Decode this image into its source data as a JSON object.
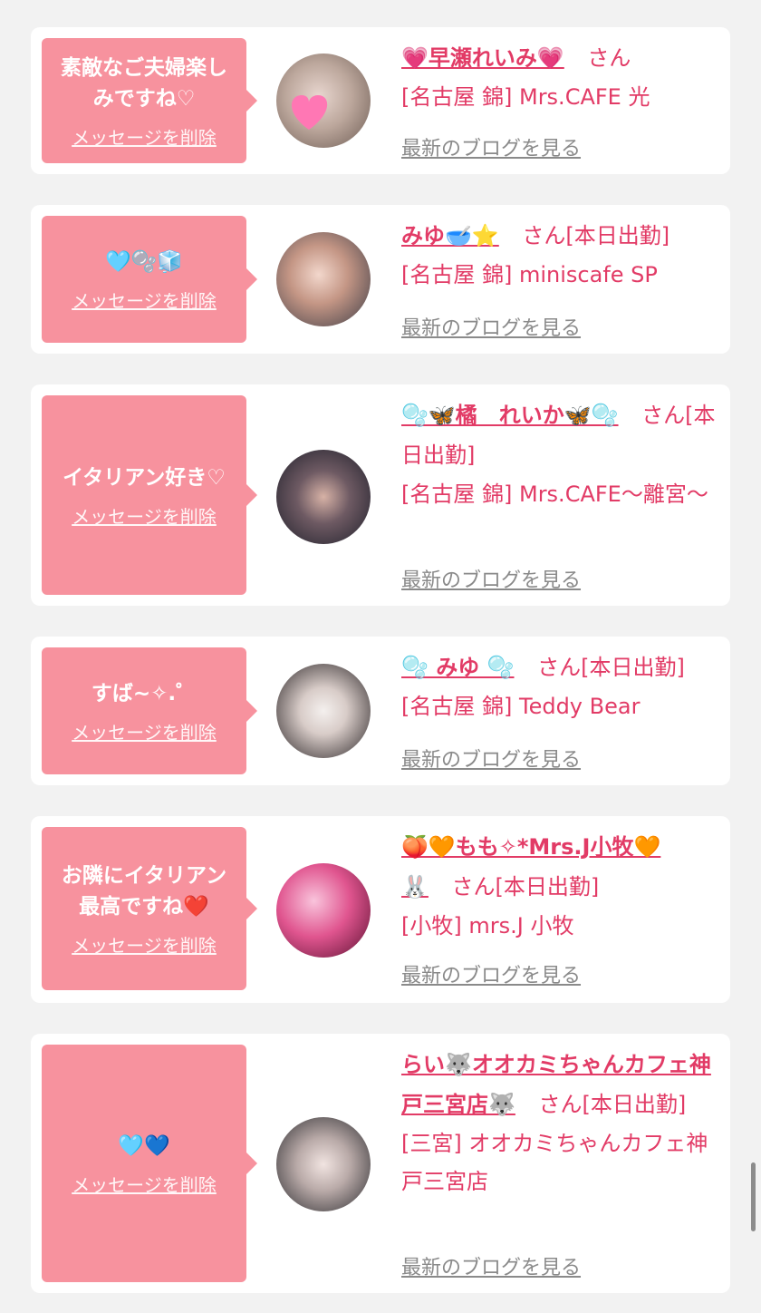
{
  "cards": [
    {
      "message": "素敵なご夫婦楽しみですね♡",
      "delete_label": "メッセージを削除",
      "name": "💗早瀬れいみ💗",
      "san": "さん",
      "status": "",
      "shop": "[名古屋 錦] Mrs.CAFE 光",
      "blog_label": "最新のブログを見る"
    },
    {
      "message": "🩵🫧🧊",
      "delete_label": "メッセージを削除",
      "name": "みゆ🥣⭐️",
      "san": "さん",
      "status": "[本日出勤]",
      "shop": "[名古屋 錦] miniscafe SP",
      "blog_label": "最新のブログを見る"
    },
    {
      "message": "イタリアン好き♡",
      "delete_label": "メッセージを削除",
      "name": "🫧🦋橘　れいか🦋🫧",
      "san": "さん",
      "status": "[本日出勤]",
      "shop": "[名古屋 錦] Mrs.CAFE〜離宮〜",
      "blog_label": "最新のブログを見る"
    },
    {
      "message": "すば~✧.゜",
      "delete_label": "メッセージを削除",
      "name": "🫧 みゆ 🫧",
      "san": "さん",
      "status": "[本日出勤]",
      "shop": "[名古屋 錦] Teddy Bear",
      "blog_label": "最新のブログを見る"
    },
    {
      "message": "お隣にイタリアン最高ですね❤️",
      "delete_label": "メッセージを削除",
      "name": "🍑🧡もも✧*Mrs.J小牧🧡",
      "name_extra": "🐰",
      "san": "さん",
      "status": "[本日出勤]",
      "shop": "[小牧] mrs.J 小牧",
      "blog_label": "最新のブログを見る"
    },
    {
      "message": "🩵💙",
      "delete_label": "メッセージを削除",
      "name": "らい🐺オオカミちゃんカフェ神戸三宮店🐺",
      "san": "さん",
      "status": "[本日出勤]",
      "shop": "[三宮] オオカミちゃんカフェ神戸三宮店",
      "blog_label": "最新のブログを見る"
    }
  ],
  "colors": {
    "bubble": "#f7929e",
    "accent": "#e23b66",
    "link_gray": "#8a8a8a"
  }
}
